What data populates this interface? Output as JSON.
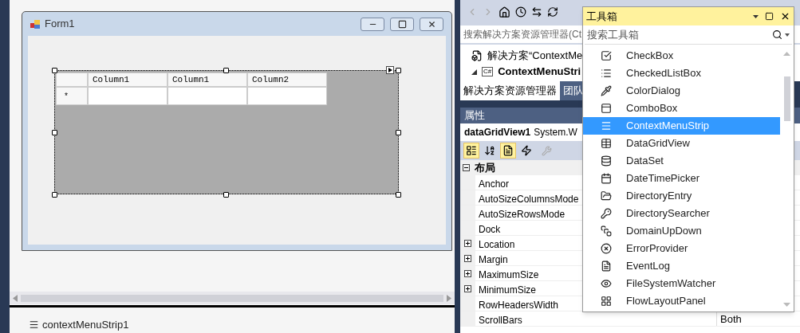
{
  "designer": {
    "form": {
      "title": "Form1",
      "grid": {
        "columns": [
          "Column1",
          "Column1",
          "Column2"
        ],
        "new_row_marker": "*"
      }
    },
    "tray": [
      {
        "label": "contextMenuStrip1"
      }
    ]
  },
  "solution_explorer": {
    "search": {
      "placeholder": "搜索解决方案资源管理器(Ct"
    },
    "tree": [
      {
        "label": "解决方案“ContextMe",
        "bold": false,
        "children": [
          {
            "label": "ContextMenuStri",
            "badge": "C#",
            "bold": true,
            "expanded": true
          }
        ]
      }
    ],
    "tabs": [
      {
        "label": "解决方案资源管理器",
        "selected": true
      },
      {
        "label": "团队",
        "selected": false
      }
    ]
  },
  "properties": {
    "title": "属性",
    "object": {
      "name": "dataGridView1",
      "type": "System.W"
    },
    "toolbar": [
      {
        "kind": "categorized",
        "selected": true
      },
      {
        "kind": "alphabetical",
        "selected": false
      },
      {
        "kind": "properties",
        "selected": true
      },
      {
        "kind": "events",
        "selected": false
      }
    ],
    "categories": [
      {
        "label": "布局",
        "expanded": true,
        "rows": [
          {
            "name": "Anchor",
            "expandable": false
          },
          {
            "name": "AutoSizeColumnsMode",
            "expandable": false
          },
          {
            "name": "AutoSizeRowsMode",
            "expandable": false
          },
          {
            "name": "Dock",
            "expandable": false
          },
          {
            "name": "Location",
            "expandable": true
          },
          {
            "name": "Margin",
            "expandable": true
          },
          {
            "name": "MaximumSize",
            "expandable": true
          },
          {
            "name": "MinimumSize",
            "expandable": true
          },
          {
            "name": "RowHeadersWidth",
            "expandable": false
          },
          {
            "name": "ScrollBars",
            "expandable": false,
            "value": "Both"
          }
        ]
      }
    ]
  },
  "toolbox": {
    "title": "工具箱",
    "search": {
      "placeholder": "搜索工具箱"
    },
    "items": [
      {
        "label": "CheckBox",
        "selected": false
      },
      {
        "label": "CheckedListBox",
        "selected": false
      },
      {
        "label": "ColorDialog",
        "selected": false
      },
      {
        "label": "ComboBox",
        "selected": false
      },
      {
        "label": "ContextMenuStrip",
        "selected": true
      },
      {
        "label": "DataGridView",
        "selected": false
      },
      {
        "label": "DataSet",
        "selected": false
      },
      {
        "label": "DateTimePicker",
        "selected": false
      },
      {
        "label": "DirectoryEntry",
        "selected": false
      },
      {
        "label": "DirectorySearcher",
        "selected": false
      },
      {
        "label": "DomainUpDown",
        "selected": false
      },
      {
        "label": "ErrorProvider",
        "selected": false
      },
      {
        "label": "EventLog",
        "selected": false
      },
      {
        "label": "FileSystemWatcher",
        "selected": false
      },
      {
        "label": "FlowLayoutPanel",
        "selected": false
      }
    ]
  }
}
